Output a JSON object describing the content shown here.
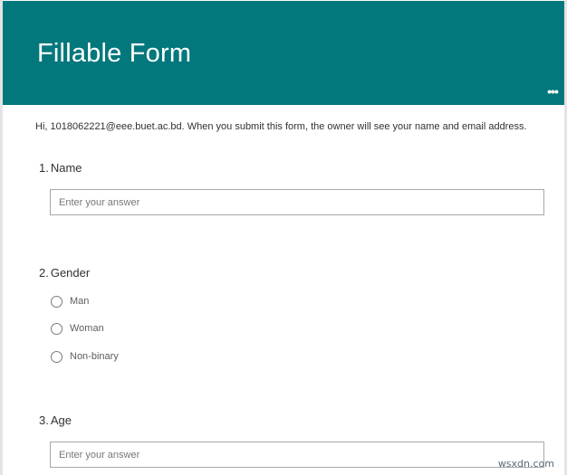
{
  "header": {
    "title": "Fillable Form",
    "more_label": "•••",
    "background_color": "#03787c"
  },
  "notice": "Hi, 1018062221@eee.buet.ac.bd. When you submit this form, the owner will see your name and email address.",
  "questions": [
    {
      "number": "1.",
      "title": "Name",
      "type": "text",
      "placeholder": "Enter your answer"
    },
    {
      "number": "2.",
      "title": "Gender",
      "type": "choice",
      "options": [
        "Man",
        "Woman",
        "Non-binary"
      ]
    },
    {
      "number": "3.",
      "title": "Age",
      "type": "text",
      "placeholder": "Enter your answer"
    }
  ],
  "watermark": "wsxdn.com"
}
